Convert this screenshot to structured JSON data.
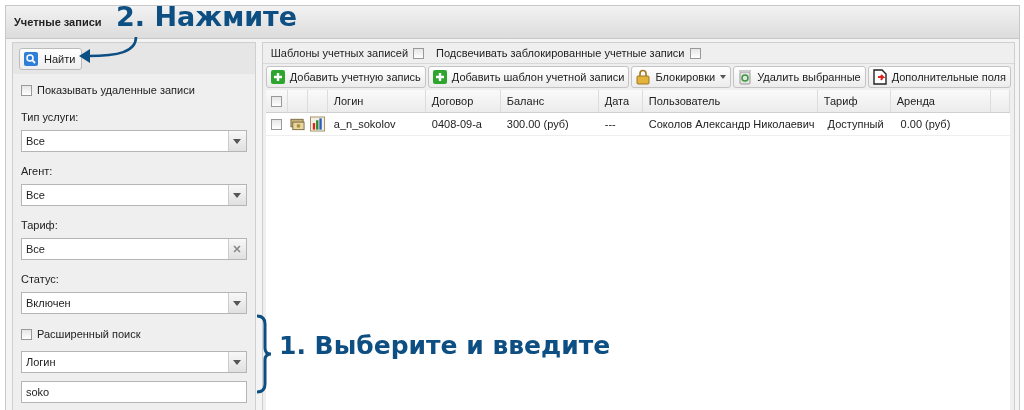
{
  "window": {
    "title": "Учетные записи"
  },
  "annotations": [
    {
      "kind": "click",
      "text": "2. Нажмите"
    },
    {
      "kind": "select",
      "text": "1. Выберите и введите"
    }
  ],
  "filter": {
    "find_button": "Найти",
    "show_deleted": {
      "label": "Показывать удаленные записи",
      "checked": false
    },
    "fields": [
      {
        "label": "Тип услуги:",
        "value": "Все",
        "kind": "select"
      },
      {
        "label": "Агент:",
        "value": "Все",
        "kind": "select"
      },
      {
        "label": "Тариф:",
        "value": "Все",
        "kind": "clearable"
      },
      {
        "label": "Статус:",
        "value": "Включен",
        "kind": "select"
      }
    ],
    "advanced_search": {
      "label": "Расширенный поиск",
      "checked": false
    },
    "search_by": {
      "value": "Логин"
    },
    "search_text": {
      "value": "soko"
    }
  },
  "options": [
    {
      "label": "Шаблоны учетных записей",
      "checked": false
    },
    {
      "label": "Подсвечивать заблокированные учетные записи",
      "checked": false
    }
  ],
  "toolbar": [
    {
      "label": "Добавить учетную запись",
      "has_menu": false
    },
    {
      "label": "Добавить шаблон учетной записи",
      "has_menu": false
    },
    {
      "label": "Блокировки",
      "has_menu": true
    },
    {
      "label": "Удалить выбранные",
      "has_menu": false
    },
    {
      "label": "Дополнительные поля",
      "has_menu": false
    }
  ],
  "table": {
    "all_checked": false,
    "columns": [
      "Логин",
      "Договор",
      "Баланс",
      "Дата",
      "Пользователь",
      "Тариф",
      "Аренда"
    ],
    "rows": [
      {
        "checked": false,
        "cells": [
          "a_n_sokolov",
          "0408-09-a",
          "300.00 (руб)",
          "---",
          "Соколов Александр Николаевич",
          "Доступный",
          "0.00 (руб)"
        ]
      }
    ]
  }
}
